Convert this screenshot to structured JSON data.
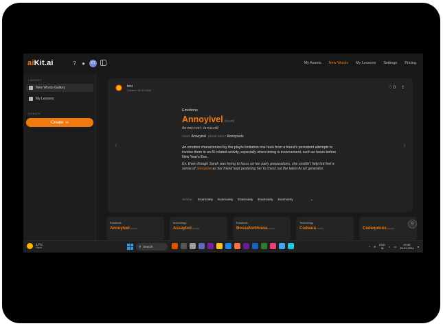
{
  "app": {
    "logo_prefix": "ai",
    "logo_suffix": "Kit.ai",
    "avatar_initials": "KT"
  },
  "nav": {
    "items": [
      "My Assets",
      "New Words",
      "My Lessons",
      "Settings",
      "Pricing"
    ],
    "active_index": 1
  },
  "sidebar": {
    "library_label": "LIBRARY",
    "items": [
      {
        "label": "New Words Gallery",
        "icon": "gallery-icon",
        "active": true
      },
      {
        "label": "My Lessons",
        "icon": "lessons-icon",
        "active": false
      }
    ],
    "create_label": "CREATE",
    "create_button": "Create",
    "create_button_icon": "∞"
  },
  "card": {
    "user_name": "test",
    "created": "Created: 01-01-2024",
    "likes": "0",
    "category": "Emotions",
    "word": "Annoyivel",
    "pos": "(noun)",
    "pronunciation": "An-noy-i-vel - /ə nɔɪ.vəl/",
    "noun_label": "noun:",
    "noun_value": "Annoyivel",
    "plural_label": "plural noun:",
    "plural_value": "Annoyivels",
    "definition": "An emotion characterized by the playful imitation one feels from a friend's persistent attempts to involve them in an AI-related activity, especially when timing is inconvenient, such as hours before New Year's Eve.",
    "example_pre": "Ex. Even though Sarah was trying to focus on her party preparations, she couldn't help but feel a sense of ",
    "example_highlight": "annoyivel",
    "example_post": " as her friend kept pestering her to check out the latest AI art generator.",
    "similar_label": "Similar:",
    "similar": [
      "Examxiety",
      "Examxiety",
      "Examxiety",
      "Examxiety",
      "Examxiety"
    ]
  },
  "bottom_cards": [
    {
      "category": "Emotions",
      "word": "Annoyivel",
      "pos": "(noun)"
    },
    {
      "category": "technology",
      "word": "Assaybot",
      "pos": "(noun)"
    },
    {
      "category": "Emotions",
      "word": "BossaNoShowa",
      "pos": "(noun)"
    },
    {
      "category": "Technology",
      "word": "Codeara",
      "pos": "(noun)"
    },
    {
      "category": "",
      "word": "Codequinox",
      "pos": "(noun)"
    }
  ],
  "taskbar": {
    "temperature": "17°C",
    "weather_text": "Haze",
    "search_label": "Search",
    "lang_top": "ENG",
    "lang_bottom": "IN",
    "time": "20:46",
    "date": "25-01-2024"
  },
  "colors": {
    "accent": "#f07a12",
    "background": "#1a1a1a"
  }
}
